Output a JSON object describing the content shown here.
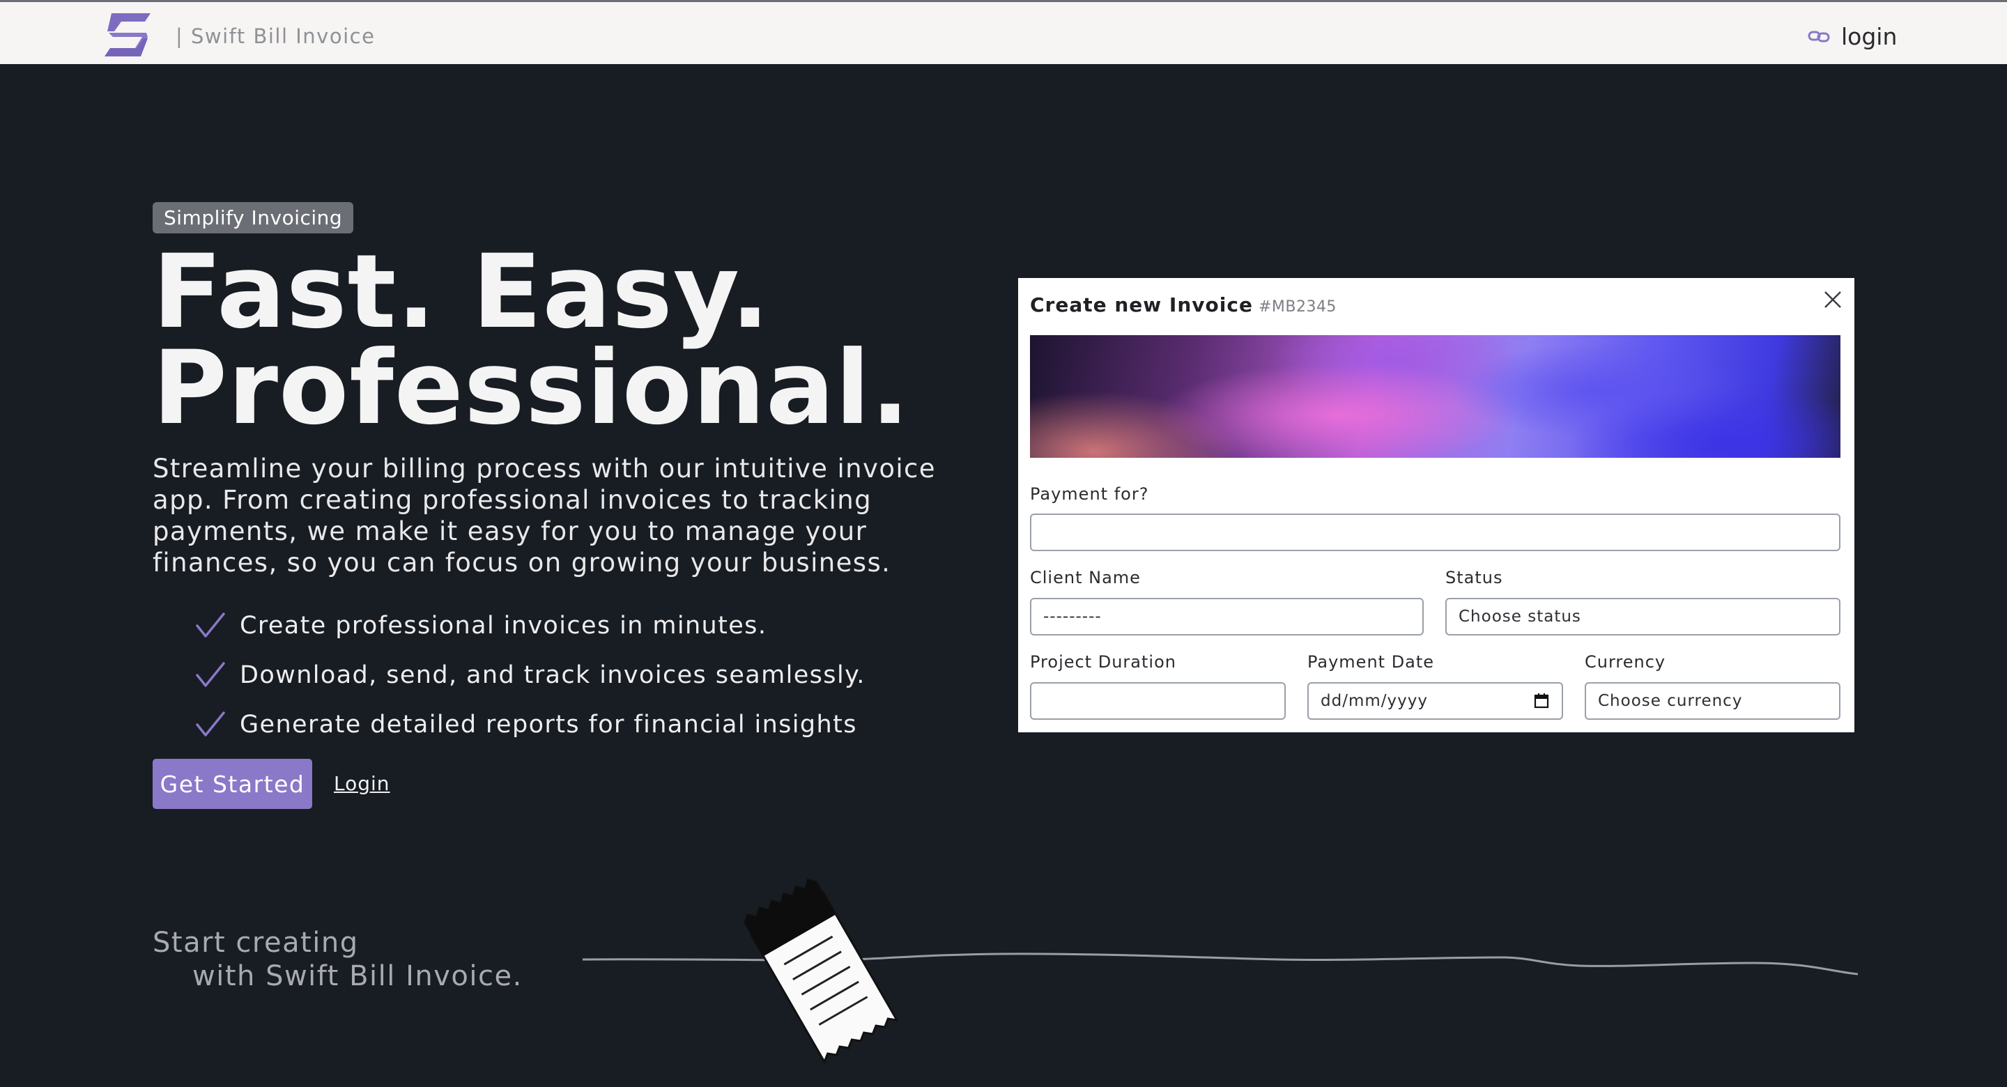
{
  "header": {
    "brand": "| Swift Bill Invoice",
    "login_label": "login"
  },
  "hero": {
    "badge": "Simplify Invoicing",
    "headline_line1": "Fast. Easy.",
    "headline_line2": "Professional.",
    "lead": "Streamline your billing process with our intuitive invoice app. From creating professional invoices to tracking payments, we make it easy for you to manage your finances, so you can focus on growing your business.",
    "features": [
      "Create professional invoices in minutes.",
      "Download, send, and track invoices seamlessly.",
      "Generate detailed reports for financial insights"
    ],
    "cta_label": "Get Started",
    "login_link": "Login"
  },
  "invoice_card": {
    "title": "Create new Invoice",
    "invoice_id": "#MB2345",
    "payment_for_label": "Payment for?",
    "payment_for_value": "",
    "client_name_label": "Client Name",
    "client_name_placeholder": "---------",
    "status_label": "Status",
    "status_value": "Choose status",
    "project_duration_label": "Project Duration",
    "project_duration_value": "",
    "payment_date_label": "Payment Date",
    "payment_date_placeholder": "dd/mm/yyyy",
    "currency_label": "Currency",
    "currency_value": "Choose currency"
  },
  "footer": {
    "tagline_line1": "Start creating",
    "tagline_line2": "with Swift Bill Invoice."
  },
  "colors": {
    "background": "#181c23",
    "accent": "#8a78c8",
    "topbar": "#f6f5f4"
  },
  "icons": {
    "logo": "swift-bill-logo",
    "login": "link-icon",
    "feature": "checkmark-icon",
    "close": "close-icon",
    "calendar": "calendar-icon",
    "illustration": "receipt-icon"
  }
}
